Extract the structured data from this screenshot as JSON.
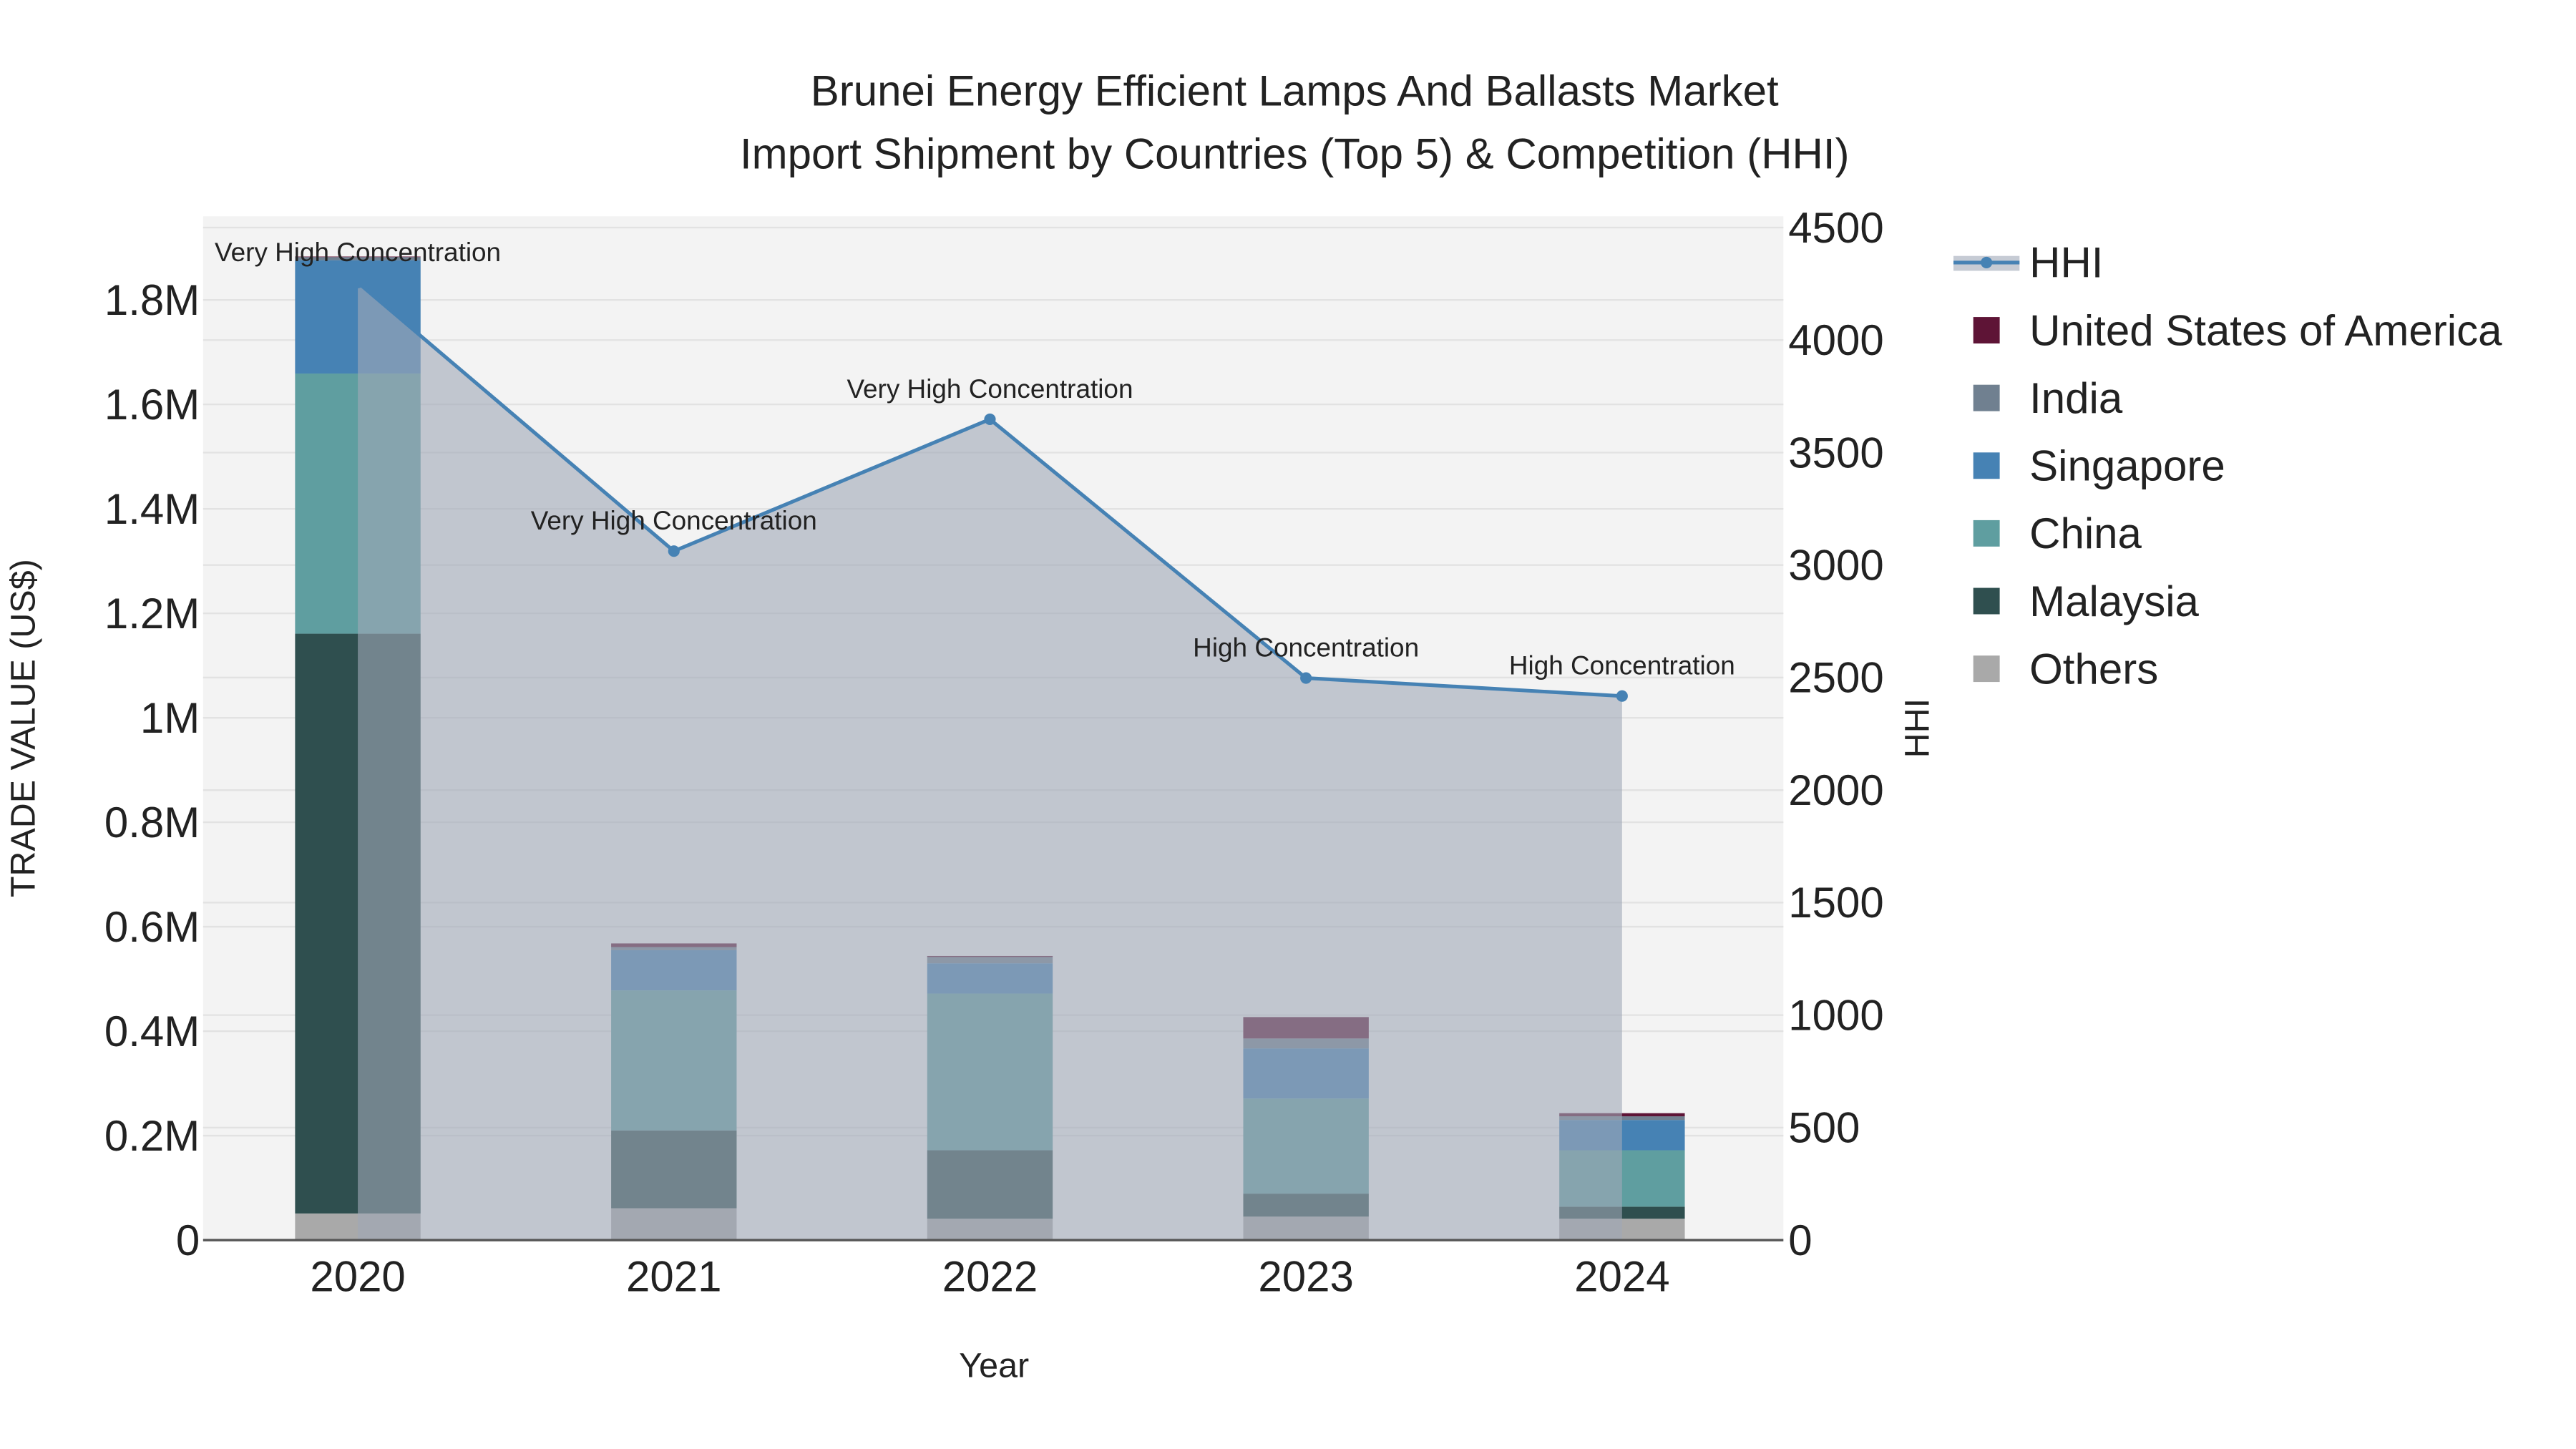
{
  "chart_data": {
    "type": "bar",
    "title": "Brunei Energy Efficient Lamps And Ballasts Market",
    "subtitle": "Import Shipment by Countries (Top 5) & Competition (HHI)",
    "xlabel": "Year",
    "ylabel": "TRADE VALUE (US$)",
    "y2label": "HHI",
    "categories": [
      "2020",
      "2021",
      "2022",
      "2023",
      "2024"
    ],
    "ylim": [
      0,
      1960000
    ],
    "y2lim": [
      0,
      4550
    ],
    "yticks": [
      0,
      200000,
      400000,
      600000,
      800000,
      1000000,
      1200000,
      1400000,
      1600000,
      1800000
    ],
    "ytick_labels": [
      "0",
      "0.2M",
      "0.4M",
      "0.6M",
      "0.8M",
      "1M",
      "1.2M",
      "1.4M",
      "1.6M",
      "1.8M"
    ],
    "y2ticks": [
      0,
      500,
      1000,
      1500,
      2000,
      2500,
      3000,
      3500,
      4000,
      4500
    ],
    "y2tick_labels": [
      "0",
      "500",
      "1000",
      "1500",
      "2000",
      "2500",
      "3000",
      "3500",
      "4000",
      "4500"
    ],
    "grid": true,
    "legend_position": "right",
    "series": [
      {
        "name": "Others",
        "color": "#a9a9a9",
        "values": [
          51000,
          61000,
          41000,
          45000,
          41000
        ]
      },
      {
        "name": "Malaysia",
        "color": "#2f4f4f",
        "values": [
          1110000,
          149000,
          131000,
          44000,
          23000
        ]
      },
      {
        "name": "China",
        "color": "#5f9ea0",
        "values": [
          498000,
          268000,
          300000,
          182000,
          108000
        ]
      },
      {
        "name": "Singapore",
        "color": "#4682b4",
        "values": [
          217000,
          77000,
          58000,
          96000,
          58000
        ]
      },
      {
        "name": "India",
        "color": "#708090",
        "values": [
          6000,
          6000,
          12000,
          19000,
          7000
        ]
      },
      {
        "name": "United States of America",
        "color": "#5e1436",
        "values": [
          1000,
          7000,
          2000,
          41000,
          6000
        ]
      }
    ],
    "hhi": {
      "name": "HHI",
      "color": "#4682b4",
      "values": [
        4256,
        3062,
        3648,
        2498,
        2418
      ],
      "annotations": [
        "Very High Concentration",
        "Very High Concentration",
        "Very High Concentration",
        "High Concentration",
        "High Concentration"
      ]
    },
    "legend": [
      "HHI",
      "United States of America",
      "India",
      "Singapore",
      "China",
      "Malaysia",
      "Others"
    ]
  }
}
